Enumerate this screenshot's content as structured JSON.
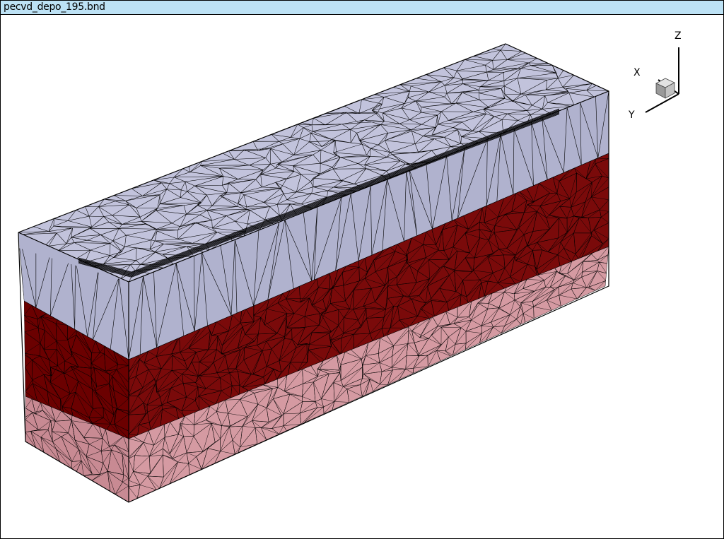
{
  "window": {
    "title": "pecvd_depo_195.bnd"
  },
  "axis_triad": {
    "labels": {
      "x": "X",
      "y": "Y",
      "z": "Z"
    }
  },
  "colors": {
    "titlebar": "#bde2f5",
    "cap_top": "#c2c3dc",
    "cap_front": "#b0b2ce",
    "middle_front": "#6b0000",
    "middle_side": "#7a0a0a",
    "base_front": "#c88a93",
    "base_side": "#d59aa2",
    "mesh_lines": "#000000"
  },
  "icons": [
    "axis-triad-icon",
    "orientation-cube-icon"
  ]
}
